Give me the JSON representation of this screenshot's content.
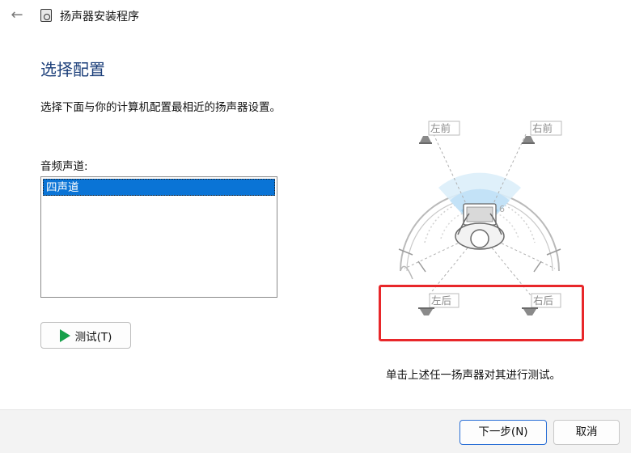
{
  "window": {
    "title": "扬声器安装程序",
    "back_icon": "arrow-left-icon",
    "app_icon": "speaker-setup-icon"
  },
  "page": {
    "heading": "选择配置",
    "instruction": "选择下面与你的计算机配置最相近的扬声器设置。",
    "channels_label": "音频声道:",
    "channels_options": [
      "四声道"
    ],
    "selected_channel": "四声道",
    "test_button": "测试(T)",
    "hint": "单击上述任一扬声器对其进行测试。"
  },
  "speakers": {
    "front_left": "左前",
    "front_right": "右前",
    "rear_left": "左后",
    "rear_right": "右后"
  },
  "footer": {
    "next_button": "下一步(N)",
    "cancel_button": "取消"
  },
  "colors": {
    "heading": "#1c3f7a",
    "selection": "#0a74d6",
    "highlight_box": "#e8272a",
    "play_icon": "#16a04a",
    "primary_border": "#2a6fd6"
  }
}
